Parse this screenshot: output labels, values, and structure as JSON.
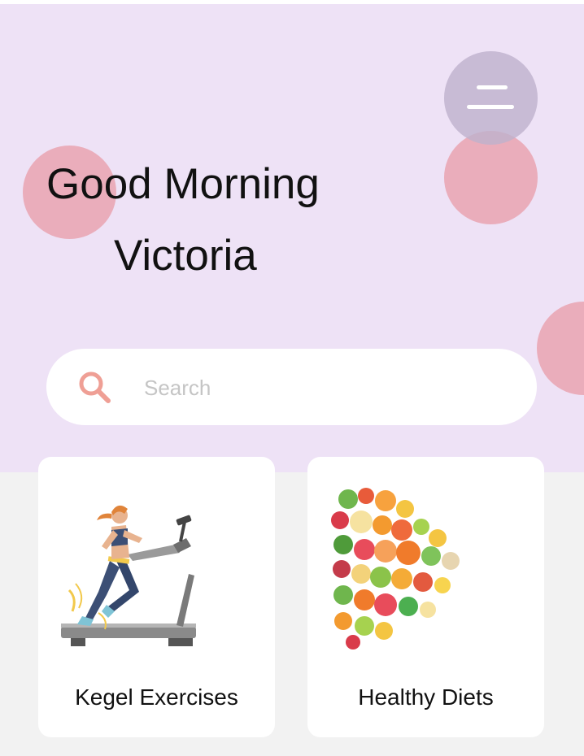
{
  "greeting": {
    "line1": "Good Morning",
    "name": "Victoria"
  },
  "menu": {
    "icon": "hamburger-menu-icon"
  },
  "search": {
    "placeholder": "Search",
    "value": "",
    "icon": "search-icon"
  },
  "cards": [
    {
      "label": "Kegel Exercises",
      "image": "treadmill-runner-illustration"
    },
    {
      "label": "Healthy Diets",
      "image": "fruit-vegetable-heart-illustration"
    }
  ],
  "colors": {
    "header_bg": "#eee2f6",
    "accent_bubble": "#e8a0ac",
    "menu_bubble": "#beb2cd",
    "page_bg": "#f2f2f2",
    "card_bg": "#ffffff"
  }
}
